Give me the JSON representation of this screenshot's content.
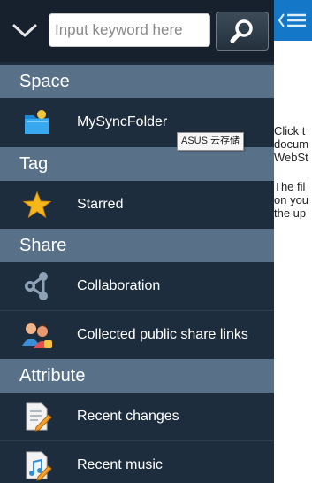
{
  "search": {
    "placeholder": "Input keyword here",
    "value": ""
  },
  "sections": {
    "space": "Space",
    "tag": "Tag",
    "share": "Share",
    "attribute": "Attribute"
  },
  "items": {
    "my_sync_folder": "MySyncFolder",
    "starred": "Starred",
    "collaboration": "Collaboration",
    "collected_links": "Collected public share links",
    "recent_changes": "Recent changes",
    "recent_music": "Recent music"
  },
  "tooltip": "ASUS 云存储",
  "content": {
    "para1": [
      "Click t",
      "docum",
      "WebSt"
    ],
    "para2": [
      "The fil",
      "on you",
      "the up"
    ]
  },
  "colors": {
    "drawer_bg": "#1d2d3d",
    "section_bg": "#587189",
    "topbar_accent": "#1477c7"
  },
  "icons": {
    "collapse": "chevron-down-icon",
    "search": "search-icon",
    "folder": "folder-icon",
    "star": "star-icon",
    "collaboration": "share-nodes-icon",
    "collected": "people-icon",
    "recent_changes": "document-pencil-icon",
    "recent_music": "music-document-icon",
    "menu": "menu-icon"
  }
}
